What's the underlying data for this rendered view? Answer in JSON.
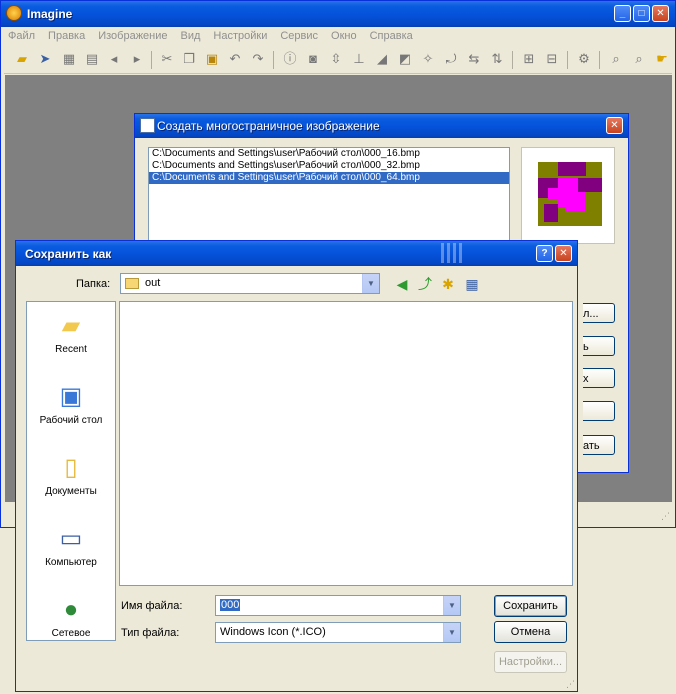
{
  "app": {
    "title": "Imagine",
    "menu": [
      "Файл",
      "Правка",
      "Изображение",
      "Вид",
      "Настройки",
      "Сервис",
      "Окно",
      "Справка"
    ]
  },
  "multipage_dialog": {
    "title": "Создать многостраничное изображение",
    "files": [
      "C:\\Documents and Settings\\user\\Рабочий стол\\000_16.bmp",
      "C:\\Documents and Settings\\user\\Рабочий стол\\000_32.bmp",
      "C:\\Documents and Settings\\user\\Рабочий стол\\000_64.bmp"
    ],
    "selected_index": 2,
    "button_fragments": [
      "л...",
      "ь",
      "х",
      "",
      "ать"
    ]
  },
  "save_dialog": {
    "title": "Сохранить как",
    "help_btn": "?",
    "close_btn": "✕",
    "folder_label": "Папка:",
    "folder_value": "out",
    "places": [
      "Recent",
      "Рабочий стол",
      "Документы",
      "Компьютер",
      "Сетевое"
    ],
    "filename_label": "Имя файла:",
    "filename_value": "000",
    "filetype_label": "Тип файла:",
    "filetype_value": "Windows Icon (*.ICO)",
    "save_button": "Сохранить",
    "cancel_button": "Отмена",
    "settings_button": "Настройки..."
  },
  "colors": {
    "title_blue": "#0553db",
    "preview_olive": "#808000",
    "preview_purple": "#800080",
    "preview_magenta": "#ff00ff"
  }
}
